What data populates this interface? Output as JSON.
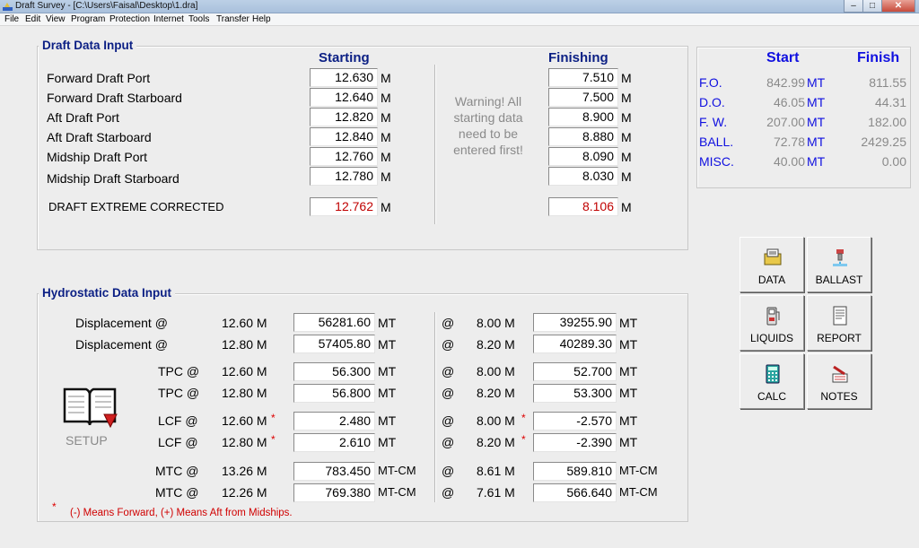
{
  "window": {
    "title": "Draft Survey - [C:\\Users\\Faisal\\Desktop\\1.dra]",
    "min": "–",
    "max": "□",
    "close": "✕"
  },
  "menu": [
    {
      "label": "File",
      "key": "F"
    },
    {
      "label": "Edit",
      "key": "E"
    },
    {
      "label": "View",
      "key": "V"
    },
    {
      "label": "Program",
      "key": "P"
    },
    {
      "label": "Protection",
      "key": "r"
    },
    {
      "label": "Internet",
      "key": "I"
    },
    {
      "label": "Tools",
      "key": "T"
    },
    {
      "label": "Transfer",
      "key": "r"
    },
    {
      "label": "Help",
      "key": "H"
    }
  ],
  "draft": {
    "title": "Draft Data Input",
    "starting_header": "Starting",
    "finishing_header": "Finishing",
    "unit": "M",
    "rows": [
      {
        "label": "Forward Draft Port",
        "start": "12.630",
        "finish": "7.510"
      },
      {
        "label": "Forward Draft Starboard",
        "start": "12.640",
        "finish": "7.500"
      },
      {
        "label": "Aft Draft Port",
        "start": "12.820",
        "finish": "8.900"
      },
      {
        "label": "Aft Draft Starboard",
        "start": "12.840",
        "finish": "8.880"
      },
      {
        "label": "Midship Draft Port",
        "start": "12.760",
        "finish": "8.090"
      },
      {
        "label": "Midship Draft Starboard",
        "start": "12.780",
        "finish": "8.030"
      }
    ],
    "corrected": {
      "label": "DRAFT EXTREME CORRECTED",
      "start": "12.762",
      "finish": "8.106"
    },
    "warning": "Warning! All starting data need to be entered first!"
  },
  "summary": {
    "start_header": "Start",
    "finish_header": "Finish",
    "unit": "MT",
    "rows": [
      {
        "label": "F.O.",
        "start": "842.99",
        "finish": "811.55"
      },
      {
        "label": "D.O.",
        "start": "46.05",
        "finish": "44.31"
      },
      {
        "label": "F. W.",
        "start": "207.00",
        "finish": "182.00"
      },
      {
        "label": "BALL.",
        "start": "72.78",
        "finish": "2429.25"
      },
      {
        "label": "MISC.",
        "start": "40.00",
        "finish": "0.00"
      }
    ]
  },
  "buttons": {
    "data": "DATA",
    "ballast": "BALLAST",
    "liquids": "LIQUIDS",
    "report": "REPORT",
    "calc": "CALC",
    "notes": "NOTES"
  },
  "hydro": {
    "title": "Hydrostatic Data Input",
    "setup_label": "SETUP",
    "at": "@",
    "rows": [
      {
        "label": "Displacement @",
        "draft_s": "12.60 M",
        "value_s": "56281.60",
        "unit": "MT",
        "draft_f": "8.00 M",
        "value_f": "39255.90"
      },
      {
        "label": "Displacement @",
        "draft_s": "12.80 M",
        "value_s": "57405.80",
        "unit": "MT",
        "draft_f": "8.20 M",
        "value_f": "40289.30"
      },
      {
        "label": "TPC @",
        "draft_s": "12.60 M",
        "value_s": "56.300",
        "unit": "MT",
        "draft_f": "8.00 M",
        "value_f": "52.700"
      },
      {
        "label": "TPC @",
        "draft_s": "12.80 M",
        "value_s": "56.800",
        "unit": "MT",
        "draft_f": "8.20 M",
        "value_f": "53.300"
      },
      {
        "label": "LCF @",
        "draft_s": "12.60 M",
        "value_s": "2.480",
        "unit": "MT",
        "draft_f": "8.00 M",
        "value_f": "-2.570"
      },
      {
        "label": "LCF @",
        "draft_s": "12.80 M",
        "value_s": "2.610",
        "unit": "MT",
        "draft_f": "8.20 M",
        "value_f": "-2.390"
      },
      {
        "label": "MTC @",
        "draft_s": "13.26 M",
        "value_s": "783.450",
        "unit": "MT-CM",
        "draft_f": "8.61 M",
        "value_f": "589.810"
      },
      {
        "label": "MTC @",
        "draft_s": "12.26 M",
        "value_s": "769.380",
        "unit": "MT-CM",
        "draft_f": "7.61 M",
        "value_f": "566.640"
      }
    ],
    "star": "*",
    "footnote": "(-)  Means Forward, (+) Means Aft from Midships."
  }
}
